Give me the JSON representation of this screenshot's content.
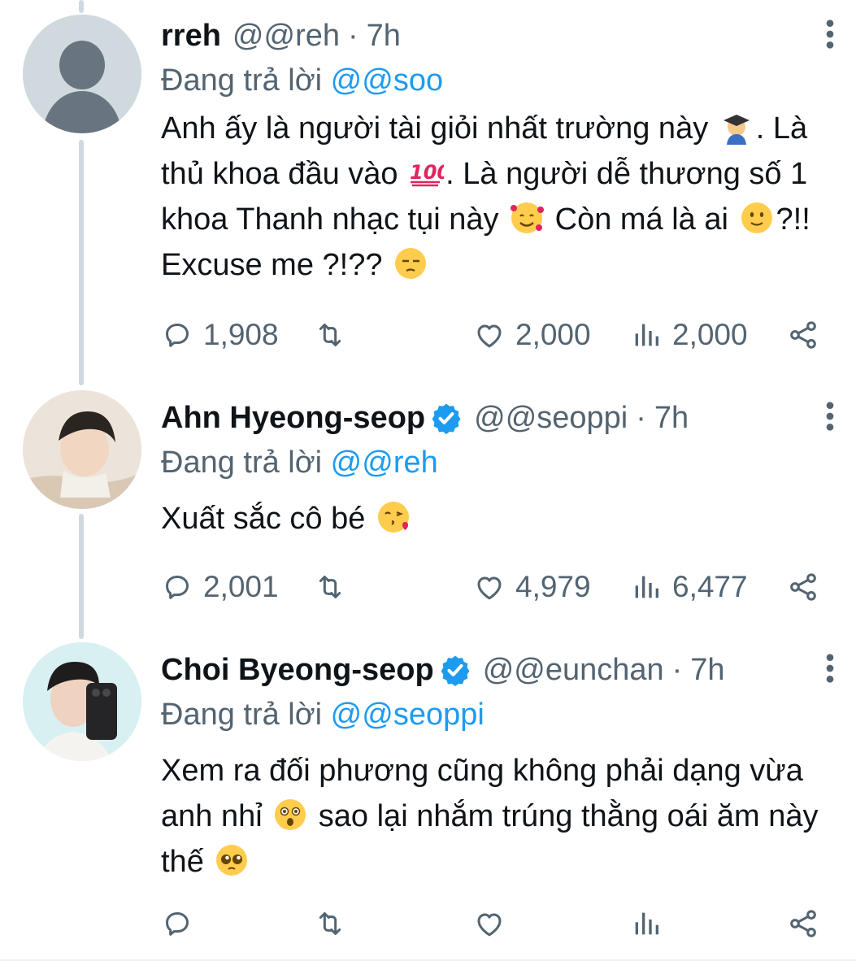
{
  "colors": {
    "text": "#0f1419",
    "secondary": "#536471",
    "accent": "#1d9bf0",
    "thread_line": "#cfd9de"
  },
  "replying_prefix": "Đang trả lời",
  "tweets": [
    {
      "name": "rreh",
      "handle": "@@reh",
      "separator": "·",
      "time": "7h",
      "verified": false,
      "avatar": "default-avatar-icon",
      "replying_to": "@@soo",
      "text_parts": [
        "Anh ấy là người tài giỏi nhất trường này ",
        ". Là thủ khoa đầu vào ",
        ". Là người dễ thương số 1 khoa Thanh nhạc tụi này ",
        " Còn má là ai ",
        "?!! Excuse me ?!?? "
      ],
      "emojis": [
        "graduate-emoji",
        "hundred-points-emoji",
        "smiling-face-with-hearts-emoji",
        "slightly-smiling-face-emoji",
        "unamused-face-emoji"
      ],
      "stats": {
        "replies": "1,908",
        "retweets": "",
        "likes": "2,000",
        "views": "2,000"
      }
    },
    {
      "name": "Ahn Hyeong-seop",
      "handle": "@@seoppi",
      "separator": "·",
      "time": "7h",
      "verified": true,
      "avatar": "profile-photo",
      "replying_to": "@@reh",
      "text_parts": [
        "Xuất sắc cô bé "
      ],
      "emojis": [
        "face-blowing-kiss-emoji"
      ],
      "stats": {
        "replies": "2,001",
        "retweets": "",
        "likes": "4,979",
        "views": "6,477"
      }
    },
    {
      "name": "Choi Byeong-seop",
      "handle": "@@eunchan",
      "separator": "·",
      "time": "7h",
      "verified": true,
      "avatar": "profile-photo",
      "replying_to": "@@seoppi",
      "text_parts": [
        "Xem ra đối phương cũng không phải dạng vừa anh nhỉ ",
        " sao lại nhắm trúng thằng oái ăm này thế "
      ],
      "emojis": [
        "astonished-face-emoji",
        "pleading-face-emoji"
      ],
      "stats": {
        "replies": "",
        "retweets": "",
        "likes": "",
        "views": ""
      }
    }
  ]
}
